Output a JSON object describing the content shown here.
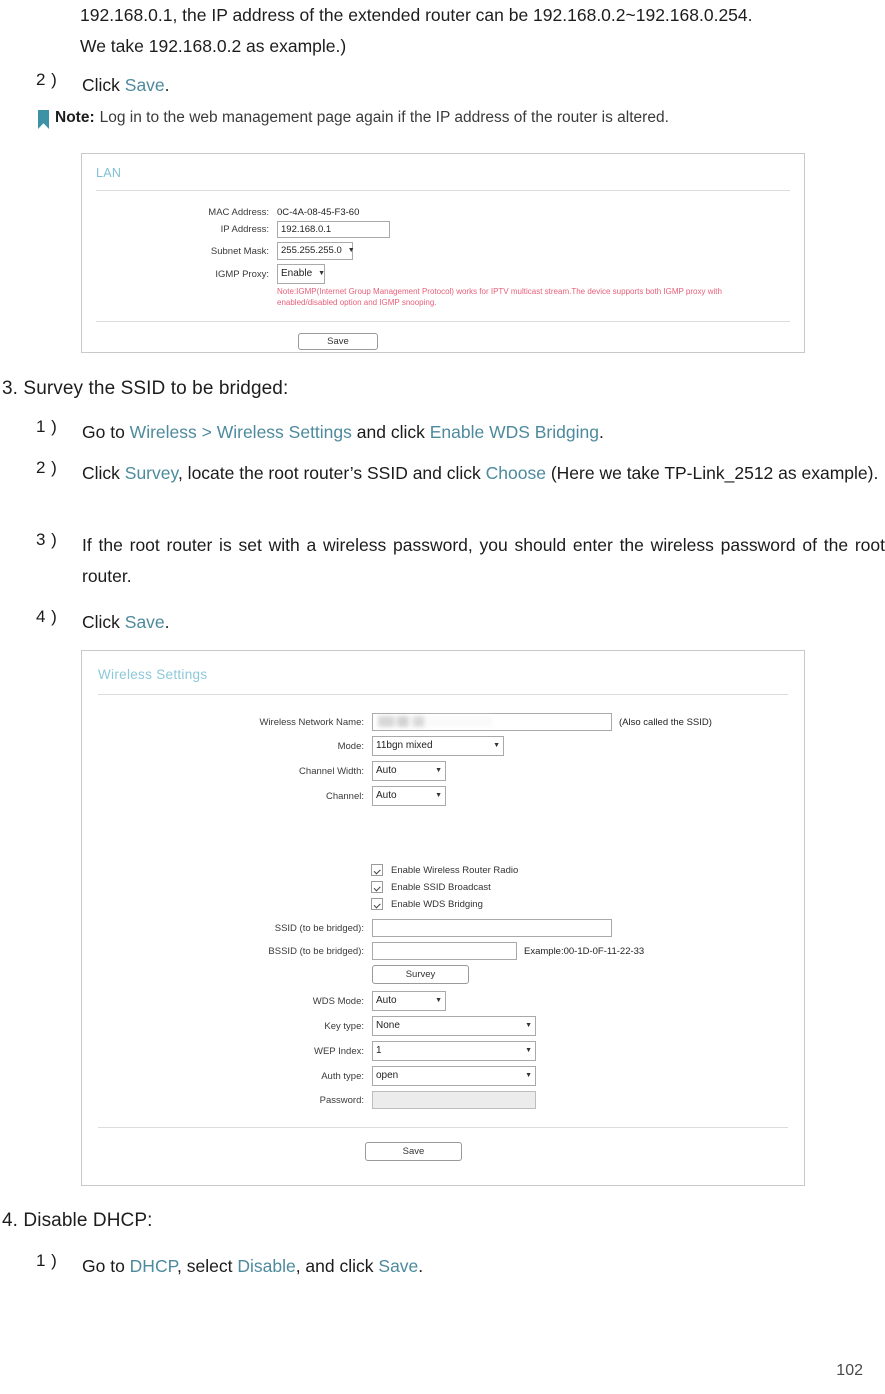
{
  "intro": {
    "line1": "192.168.0.1, the IP address of the extended router can be 192.168.0.2~192.168.0.254.",
    "line2": "We take 192.168.0.2 as example.)"
  },
  "step_click_save": {
    "num": "2 )",
    "prefix": "Click ",
    "link": "Save",
    "suffix": "."
  },
  "note": {
    "icon": "bookmark-icon",
    "label": "Note:",
    "text": "Log in to the web management page again if the IP address of the router is altered."
  },
  "lan_panel": {
    "title": "LAN",
    "fields": [
      {
        "label": "MAC Address:",
        "value": "0C-4A-08-45-F3-60",
        "kind": "text"
      },
      {
        "label": "IP Address:",
        "value": "192.168.0.1",
        "kind": "input"
      },
      {
        "label": "Subnet Mask:",
        "value": "255.255.255.0",
        "kind": "select"
      },
      {
        "label": "IGMP Proxy:",
        "value": "Enable",
        "kind": "select"
      }
    ],
    "red_note": "Note:IGMP(Internet Group Management Protocol) works for IPTV multicast stream.The device supports both IGMP proxy with enabled/disabled option and IGMP snooping.",
    "save_label": "Save"
  },
  "heading3": "3. Survey the SSID to be bridged:",
  "steps3": [
    {
      "num": "1 )",
      "parts": [
        {
          "t": "Go to ",
          "link": false
        },
        {
          "t": "Wireless",
          "link": true
        },
        {
          "t": " > ",
          "link": false
        },
        {
          "t": "Wireless Settings",
          "link": true
        },
        {
          "t": " and click ",
          "link": false
        },
        {
          "t": "Enable WDS Bridging",
          "link": true
        },
        {
          "t": ".",
          "link": false
        }
      ]
    },
    {
      "num": "2 )",
      "parts": [
        {
          "t": "Click ",
          "link": false
        },
        {
          "t": "Survey",
          "link": true
        },
        {
          "t": ", locate the root router’s SSID and click ",
          "link": false
        },
        {
          "t": "Choose",
          "link": true
        },
        {
          "t": " (Here we take TP-Link_2512 as example).",
          "link": false
        }
      ]
    },
    {
      "num": "3 )",
      "parts": [
        {
          "t": "If  the root router is set with a wireless password, you should enter the wireless password of the root router.",
          "link": false
        }
      ]
    },
    {
      "num": "4 )",
      "parts": [
        {
          "t": "Click ",
          "link": false
        },
        {
          "t": "Save",
          "link": true
        },
        {
          "t": ".",
          "link": false
        }
      ]
    }
  ],
  "wireless_panel": {
    "title": "Wireless Settings",
    "network_name_label": "Wireless Network Name:",
    "network_name_value": "",
    "network_name_hint": "(Also called the SSID)",
    "mode_label": "Mode:",
    "mode_value": "11bgn mixed",
    "channel_width_label": "Channel Width:",
    "channel_width_value": "Auto",
    "channel_label": "Channel:",
    "channel_value": "Auto",
    "checkboxes": [
      {
        "label": "Enable Wireless Router Radio",
        "checked": true
      },
      {
        "label": "Enable SSID Broadcast",
        "checked": true
      },
      {
        "label": "Enable WDS Bridging",
        "checked": true
      }
    ],
    "ssid_label": "SSID (to be bridged):",
    "ssid_value": "",
    "bssid_label": "BSSID (to be bridged):",
    "bssid_value": "",
    "bssid_example": "Example:00-1D-0F-11-22-33",
    "survey_label": "Survey",
    "wds_mode_label": "WDS Mode:",
    "wds_mode_value": "Auto",
    "key_type_label": "Key type:",
    "key_type_value": "None",
    "wep_index_label": "WEP Index:",
    "wep_index_value": "1",
    "auth_type_label": "Auth type:",
    "auth_type_value": "open",
    "password_label": "Password:",
    "password_value": "",
    "save_label": "Save"
  },
  "heading4": "4. Disable DHCP:",
  "steps4": [
    {
      "num": "1 )",
      "parts": [
        {
          "t": "Go to ",
          "link": false
        },
        {
          "t": "DHCP",
          "link": true
        },
        {
          "t": ", select ",
          "link": false
        },
        {
          "t": "Disable",
          "link": true
        },
        {
          "t": ",  and click ",
          "link": false
        },
        {
          "t": "Save",
          "link": true
        },
        {
          "t": ".",
          "link": false
        }
      ]
    }
  ],
  "page_number": "102",
  "colors": {
    "link": "#4d8a9d",
    "panel_title": "#7fc2d6",
    "red_note": "#e8607a"
  }
}
